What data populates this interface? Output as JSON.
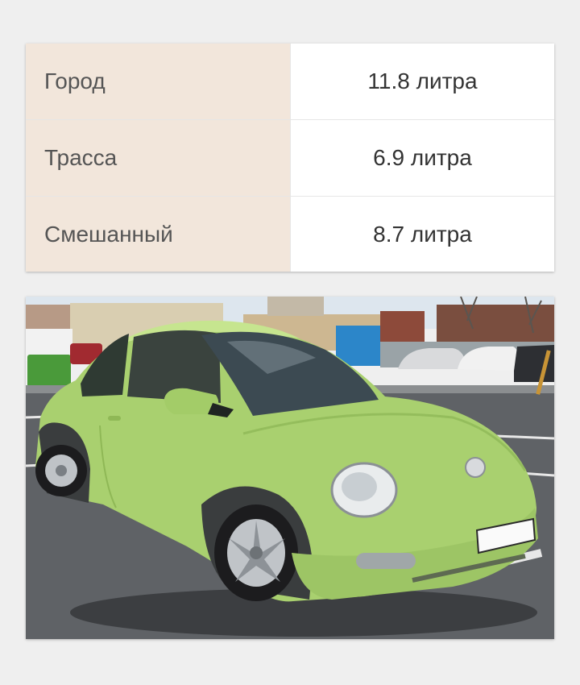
{
  "consumption": {
    "rows": [
      {
        "label": "Город",
        "value": "11.8 литра"
      },
      {
        "label": "Трасса",
        "value": "6.9 литра"
      },
      {
        "label": "Смешанный",
        "value": "8.7 литра"
      }
    ]
  },
  "photo": {
    "subject": "car-photo",
    "colors": {
      "car_body": "#a9d06f",
      "sky": "#dde6ee",
      "asphalt": "#5f6266",
      "lawn": "#4f7d2a"
    }
  }
}
